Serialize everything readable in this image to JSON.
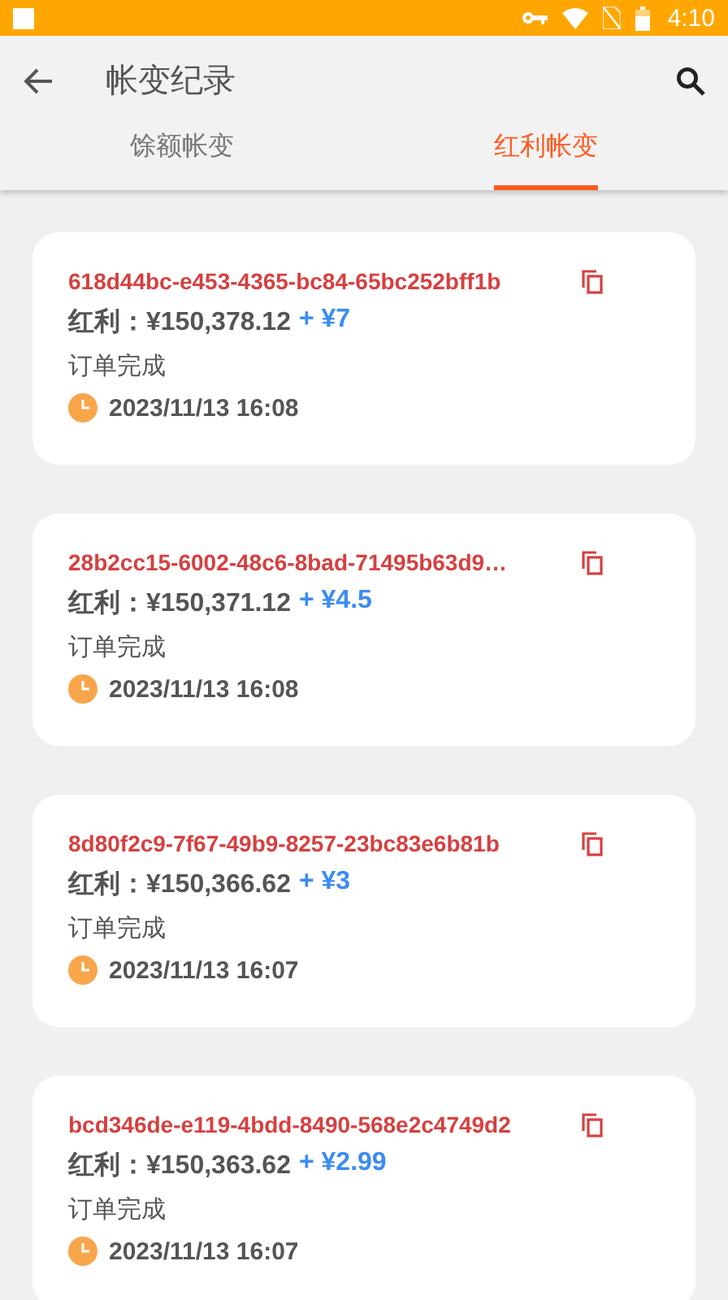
{
  "status_bar": {
    "time": "4:10"
  },
  "app_bar": {
    "title": "帐变纪录"
  },
  "tabs": [
    {
      "label": "馀额帐变",
      "selected": false
    },
    {
      "label": "红利帐变",
      "selected": true
    }
  ],
  "records": [
    {
      "id": "618d44bc-e453-4365-bc84-65bc252bff1b",
      "balance": "红利：¥150,378.12",
      "change": "+ ¥7",
      "status": "订单完成",
      "time": "2023/11/13 16:08"
    },
    {
      "id": "28b2cc15-6002-48c6-8bad-71495b63d9…",
      "balance": "红利：¥150,371.12",
      "change": "+ ¥4.5",
      "status": "订单完成",
      "time": "2023/11/13 16:08"
    },
    {
      "id": "8d80f2c9-7f67-49b9-8257-23bc83e6b81b",
      "balance": "红利：¥150,366.62",
      "change": "+ ¥3",
      "status": "订单完成",
      "time": "2023/11/13 16:07"
    },
    {
      "id": "bcd346de-e119-4bdd-8490-568e2c4749d2",
      "balance": "红利：¥150,363.62",
      "change": "+ ¥2.99",
      "status": "订单完成",
      "time": "2023/11/13 16:07"
    }
  ]
}
